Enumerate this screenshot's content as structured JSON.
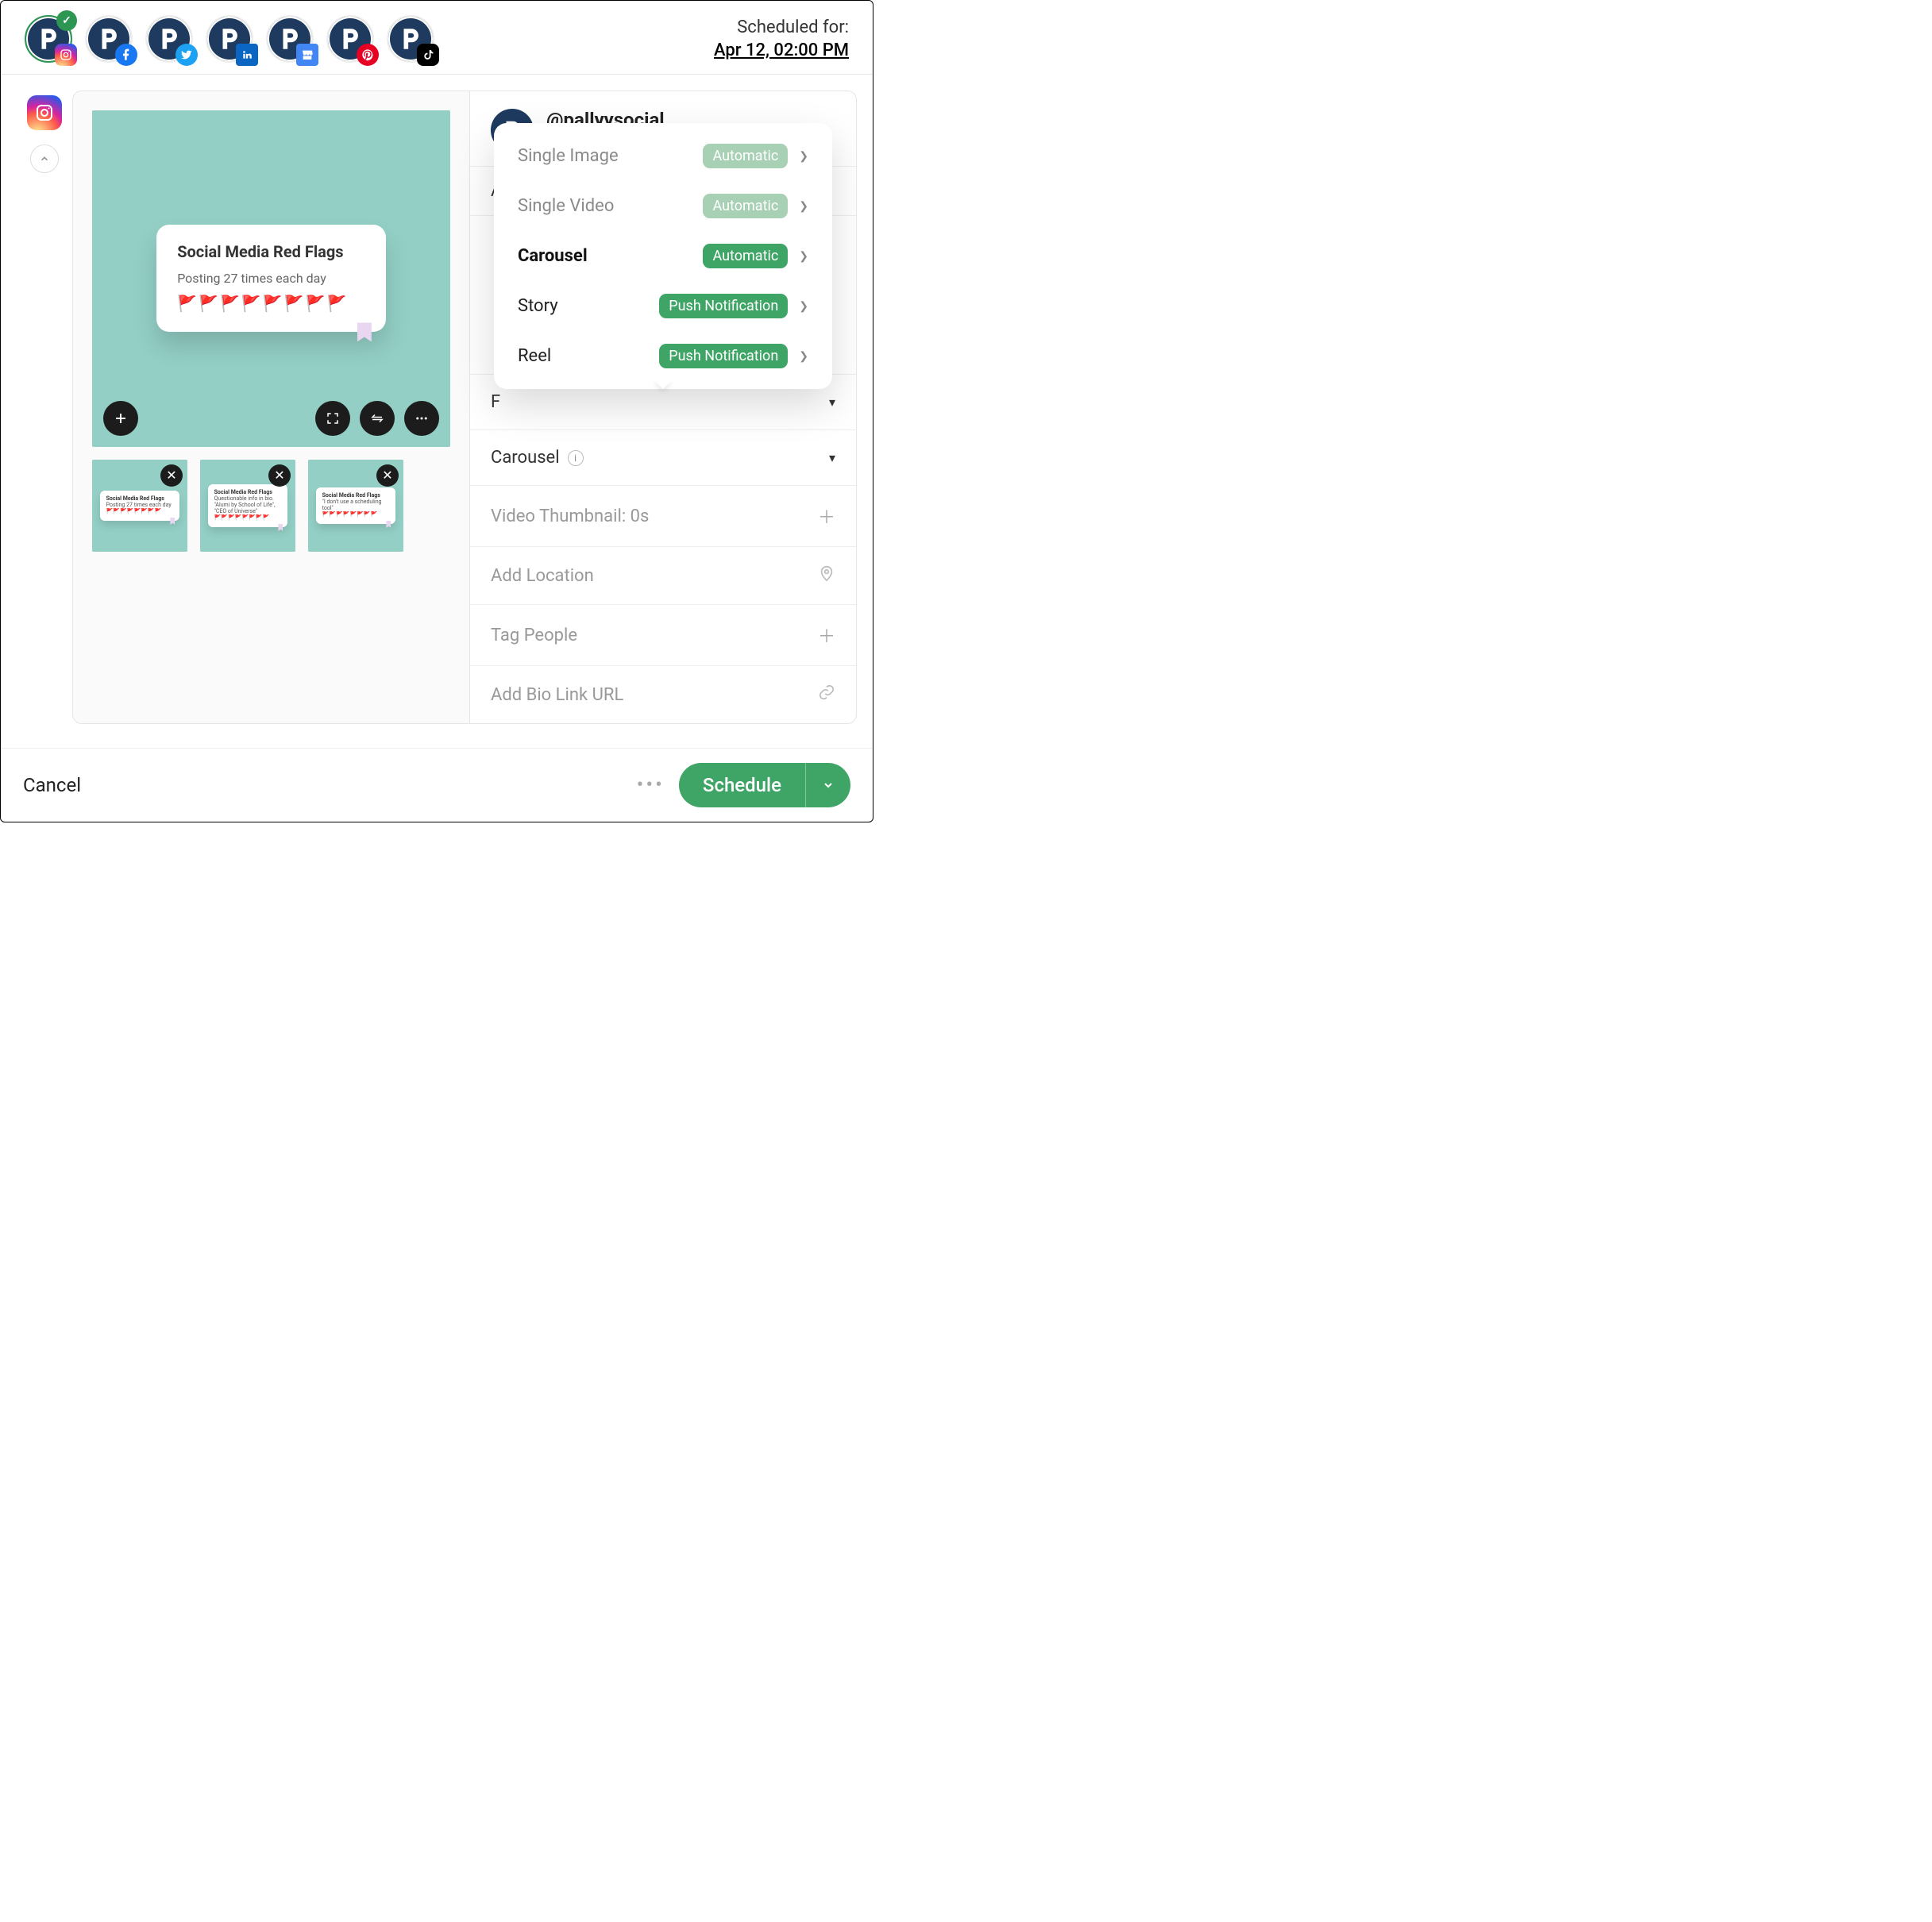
{
  "header": {
    "scheduled_label": "Scheduled for:",
    "scheduled_datetime": "Apr 12, 02:00 PM",
    "accounts": [
      {
        "network": "instagram",
        "selected": true
      },
      {
        "network": "facebook",
        "selected": false
      },
      {
        "network": "twitter",
        "selected": false
      },
      {
        "network": "linkedin",
        "selected": false
      },
      {
        "network": "gmb",
        "selected": false
      },
      {
        "network": "pinterest",
        "selected": false
      },
      {
        "network": "tiktok",
        "selected": false
      }
    ]
  },
  "account": {
    "handle": "@pallyysocial",
    "platform": "Instagram"
  },
  "preview": {
    "card_title": "Social Media Red Flags",
    "card_subtitle": "Posting 27 times each day",
    "card_flags": "🚩🚩🚩🚩🚩🚩🚩🚩",
    "thumbs": [
      {
        "title": "Social Media Red Flags",
        "subtitle": "Posting 27 times each day",
        "flags": "🚩🚩🚩🚩🚩🚩🚩🚩"
      },
      {
        "title": "Social Media Red Flags",
        "subtitle": "Questionable info in bio. \"Alumi by School of Life\", \"CEO of Universe\"",
        "flags": "🚩🚩🚩🚩🚩🚩🚩🚩"
      },
      {
        "title": "Social Media Red Flags",
        "subtitle": "\"I don't use a scheduling tool\"",
        "flags": "🚩🚩🚩🚩🚩🚩🚩🚩"
      }
    ]
  },
  "post_type_menu": {
    "items": [
      {
        "name": "Single Image",
        "badge": "Automatic",
        "badge_strong": false,
        "selected": false,
        "enabled": false
      },
      {
        "name": "Single Video",
        "badge": "Automatic",
        "badge_strong": false,
        "selected": false,
        "enabled": false
      },
      {
        "name": "Carousel",
        "badge": "Automatic",
        "badge_strong": true,
        "selected": true,
        "enabled": true
      },
      {
        "name": "Story",
        "badge": "Push Notification",
        "badge_strong": true,
        "selected": false,
        "enabled": true
      },
      {
        "name": "Reel",
        "badge": "Push Notification",
        "badge_strong": true,
        "selected": false,
        "enabled": true
      }
    ]
  },
  "sections": {
    "hidden_a_label": "A",
    "hidden_f_label": "F",
    "carousel_label": "Carousel",
    "video_thumb_label": "Video Thumbnail: 0s",
    "location_label": "Add Location",
    "tag_people_label": "Tag People",
    "bio_link_label": "Add Bio Link URL"
  },
  "footer": {
    "cancel": "Cancel",
    "schedule": "Schedule"
  }
}
